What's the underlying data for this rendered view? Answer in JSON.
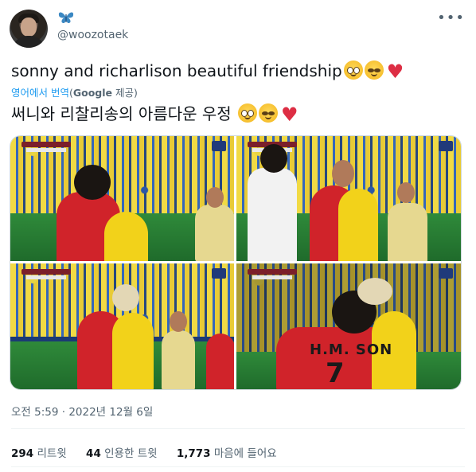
{
  "author": {
    "handle": "@woozotaek",
    "badge_icon": "butterfly-icon"
  },
  "tweet": {
    "text": "sonny and richarlison beautiful friendship",
    "translate_prefix": "영어에서 번역",
    "translate_open": "(",
    "translate_brand": "Google",
    "translate_suffix": " 제공)",
    "translated_text": "써니와 리찰리송의 아름다운 우정",
    "emojis": [
      "pleading-face-emoji",
      "relieved-face-emoji",
      "red-heart-emoji"
    ]
  },
  "media": {
    "count": 4,
    "photos": [
      "photo-1",
      "photo-2",
      "photo-3",
      "photo-4"
    ],
    "jersey_text": "H.M. SON",
    "jersey_number": "7"
  },
  "timestamp": "오전 5:59 · 2022년 12월 6일",
  "stats": {
    "retweets_count": "294",
    "retweets_label": "리트윗",
    "quotes_count": "44",
    "quotes_label": "인용한 트윗",
    "likes_count": "1,773",
    "likes_label": "마음에 들어요"
  },
  "colors": {
    "link": "#1d9bf0",
    "secondary_text": "#536471",
    "heart": "#dd2e44"
  }
}
